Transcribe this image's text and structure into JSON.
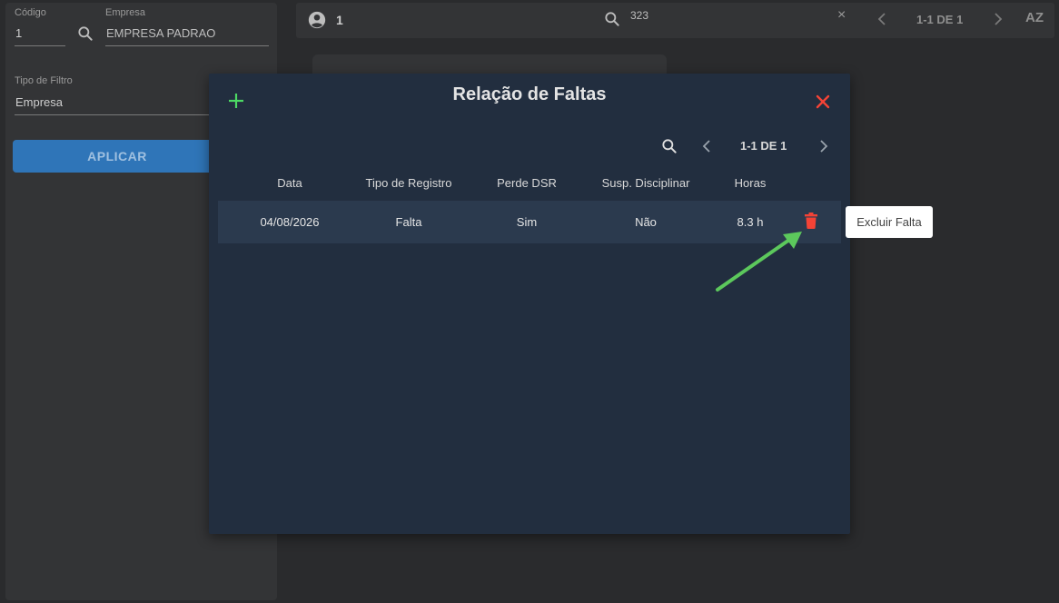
{
  "filter_panel": {
    "codigo_label": "Código",
    "codigo_value": "1",
    "empresa_label": "Empresa",
    "empresa_value": "EMPRESA PADRAO",
    "tipo_filtro_label": "Tipo de Filtro",
    "tipo_filtro_value": "Empresa",
    "apply_label": "APLICAR"
  },
  "topbar": {
    "user_count": "1",
    "search_value": "323",
    "clear_symbol": "×",
    "page_info": "1-1 DE 1",
    "sort_label": "AZ"
  },
  "modal": {
    "title": "Relação de Faltas",
    "page_info": "1-1 DE 1",
    "columns": [
      "Data",
      "Tipo de Registro",
      "Perde DSR",
      "Susp. Disciplinar",
      "Horas"
    ],
    "rows": [
      {
        "data": "04/08/2026",
        "tipo": "Falta",
        "perde_dsr": "Sim",
        "susp": "Não",
        "horas": "8.3 h"
      }
    ],
    "tooltip": "Excluir Falta"
  },
  "colors": {
    "accent_green": "#4cd964",
    "danger_red": "#f44336",
    "primary_blue": "#2f75b8",
    "modal_bg": "#222e3f"
  },
  "icons": [
    "search-icon",
    "account-circle-icon",
    "close-icon",
    "chevron-left-icon",
    "chevron-right-icon",
    "sort-alpha-icon",
    "plus-icon",
    "trash-icon"
  ]
}
